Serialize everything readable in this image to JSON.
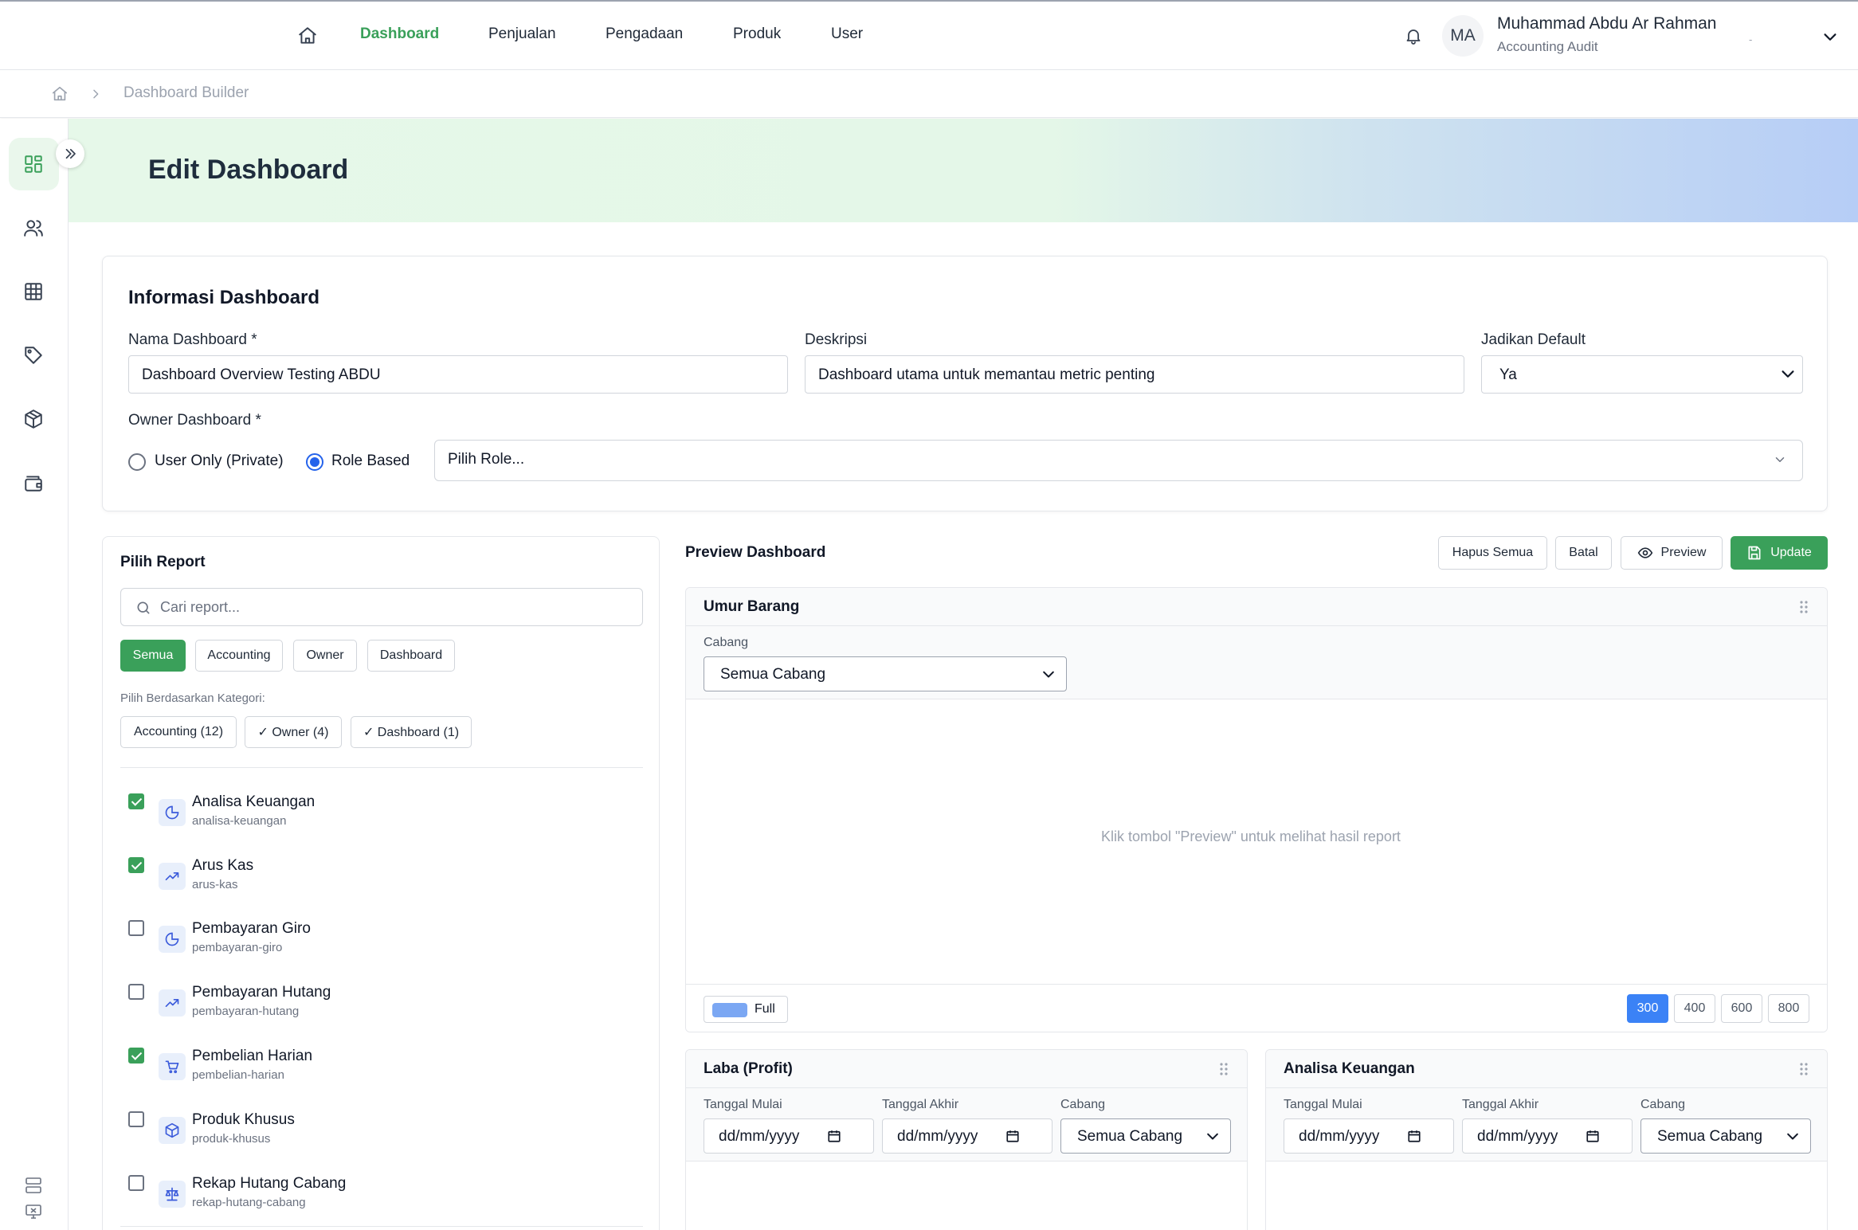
{
  "nav": {
    "items": [
      {
        "label": "Dashboard",
        "active": true
      },
      {
        "label": "Penjualan",
        "active": false
      },
      {
        "label": "Pengadaan",
        "active": false
      },
      {
        "label": "Produk",
        "active": false
      },
      {
        "label": "User",
        "active": false
      }
    ],
    "user": {
      "initials": "MA",
      "name": "Muhammad Abdu Ar Rahman",
      "role": "Accounting Audit",
      "extra": "-"
    }
  },
  "breadcrumb": {
    "current": "Dashboard Builder"
  },
  "page": {
    "title": "Edit Dashboard"
  },
  "info": {
    "title": "Informasi Dashboard",
    "name_label": "Nama Dashboard *",
    "name_value": "Dashboard Overview Testing ABDU",
    "desc_label": "Deskripsi",
    "desc_value": "Dashboard utama untuk memantau metric penting",
    "default_label": "Jadikan Default",
    "default_value": "Ya",
    "owner_label": "Owner Dashboard *",
    "owner_options": [
      {
        "label": "User Only (Private)",
        "checked": false
      },
      {
        "label": "Role Based",
        "checked": true
      }
    ],
    "role_placeholder": "Pilih Role..."
  },
  "picker": {
    "title": "Pilih Report",
    "search_placeholder": "Cari report...",
    "tabs": [
      {
        "label": "Semua",
        "active": true
      },
      {
        "label": "Accounting",
        "active": false
      },
      {
        "label": "Owner",
        "active": false
      },
      {
        "label": "Dashboard",
        "active": false
      }
    ],
    "category_label": "Pilih Berdasarkan Kategori:",
    "categories": [
      "Accounting (12)",
      "✓ Owner (4)",
      "✓ Dashboard (1)"
    ],
    "reports": [
      {
        "title": "Analisa Keuangan",
        "slug": "analisa-keuangan",
        "checked": true,
        "icon": "pie-chart-icon"
      },
      {
        "title": "Arus Kas",
        "slug": "arus-kas",
        "checked": true,
        "icon": "trending-up-icon"
      },
      {
        "title": "Pembayaran Giro",
        "slug": "pembayaran-giro",
        "checked": false,
        "icon": "pie-chart-icon"
      },
      {
        "title": "Pembayaran Hutang",
        "slug": "pembayaran-hutang",
        "checked": false,
        "icon": "trending-up-icon"
      },
      {
        "title": "Pembelian Harian",
        "slug": "pembelian-harian",
        "checked": true,
        "icon": "cart-icon"
      },
      {
        "title": "Produk Khusus",
        "slug": "produk-khusus",
        "checked": false,
        "icon": "box-icon"
      },
      {
        "title": "Rekap Hutang Cabang",
        "slug": "rekap-hutang-cabang",
        "checked": false,
        "icon": "scale-icon"
      }
    ]
  },
  "preview": {
    "title": "Preview Dashboard",
    "buttons": {
      "clear": "Hapus Semua",
      "cancel": "Batal",
      "preview": "Preview",
      "update": "Update"
    },
    "widgets": {
      "umur": {
        "title": "Umur Barang",
        "branch_label": "Cabang",
        "branch_value": "Semua Cabang",
        "message": "Klik tombol \"Preview\" untuk melihat hasil report",
        "full_label": "Full",
        "sizes": [
          "300",
          "400",
          "600",
          "800"
        ],
        "active_size": "300"
      },
      "laba": {
        "title": "Laba (Profit)",
        "start_label": "Tanggal Mulai",
        "end_label": "Tanggal Akhir",
        "branch_label": "Cabang",
        "date_placeholder": "dd/mm/yyyy",
        "branch_value": "Semua Cabang"
      },
      "analisa": {
        "title": "Analisa Keuangan",
        "start_label": "Tanggal Mulai",
        "end_label": "Tanggal Akhir",
        "branch_label": "Cabang",
        "date_placeholder": "dd/mm/yyyy",
        "branch_value": "Semua Cabang"
      }
    }
  },
  "colors": {
    "accent": "#3aa05a",
    "blue": "#3b82f6",
    "radio": "#2563eb"
  }
}
